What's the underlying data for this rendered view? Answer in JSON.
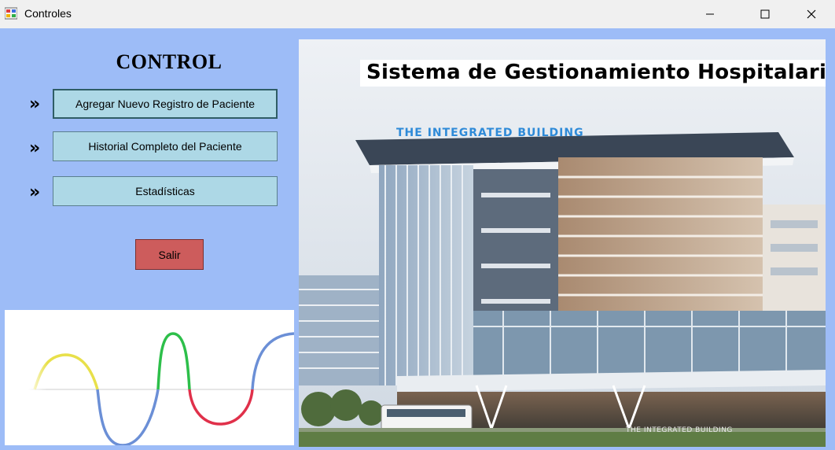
{
  "window": {
    "title": "Controles",
    "controls": {
      "minimize": "minimize-icon",
      "maximize": "maximize-icon",
      "close": "close-icon"
    }
  },
  "sidebar": {
    "heading": "CONTROL",
    "menu": [
      {
        "marker": "»",
        "label": "Agregar Nuevo Registro de Paciente"
      },
      {
        "marker": "»",
        "label": "Historial Completo del Paciente"
      },
      {
        "marker": "»",
        "label": "Estadísticas"
      }
    ],
    "exit_label": "Salir"
  },
  "banner": {
    "title": "Sistema de Gestionamiento Hospitalario",
    "building_sign": "THE INTEGRATED BUILDING",
    "building_sign_lower": "THE INTEGRATED BUILDING"
  },
  "colors": {
    "background": "#9dbcf7",
    "button": "#add8e6",
    "exit_button": "#cd5c5c",
    "wave_yellow": "#e8e04a",
    "wave_blue": "#6b8fd6",
    "wave_green": "#2dbf4a",
    "wave_red": "#e0304a"
  }
}
